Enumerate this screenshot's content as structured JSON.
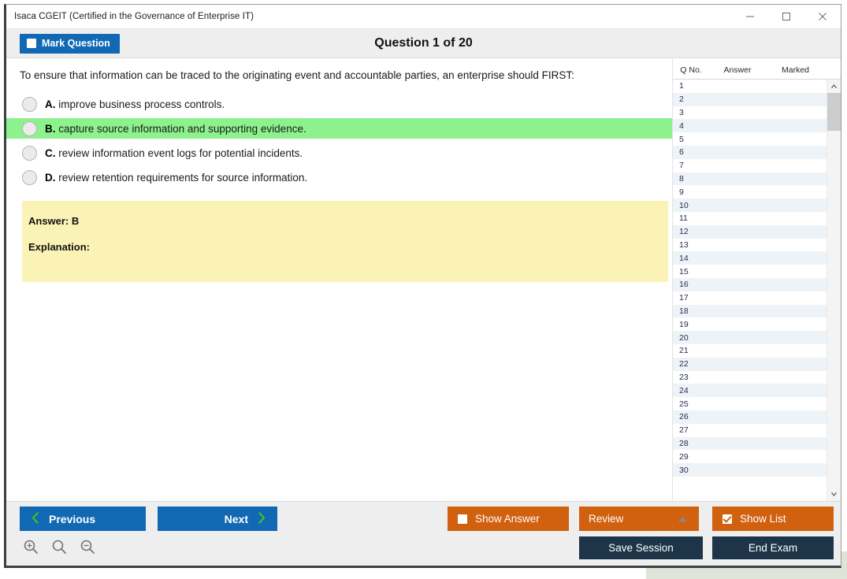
{
  "window": {
    "title": "Isaca CGEIT (Certified in the Governance of Enterprise IT)",
    "controls": {
      "minimize": "minimize-icon",
      "maximize": "maximize-icon",
      "close": "close-icon"
    }
  },
  "topbar": {
    "mark_question_label": "Mark Question",
    "mark_question_checked": false,
    "question_counter": "Question 1 of 20"
  },
  "question": {
    "text": "To ensure that information can be traced to the originating event and accountable parties, an enterprise should FIRST:",
    "options": [
      {
        "letter": "A.",
        "text": "improve business process controls.",
        "selected": false
      },
      {
        "letter": "B.",
        "text": "capture source information and supporting evidence.",
        "selected": true
      },
      {
        "letter": "C.",
        "text": "review information event logs for potential incidents.",
        "selected": false
      },
      {
        "letter": "D.",
        "text": "review retention requirements for source information.",
        "selected": false
      }
    ]
  },
  "answer_panel": {
    "answer_label": "Answer: B",
    "explanation_label": "Explanation:"
  },
  "list_panel": {
    "columns": [
      "Q No.",
      "Answer",
      "Marked"
    ],
    "rows": [
      {
        "no": "1",
        "answer": "",
        "marked": ""
      },
      {
        "no": "2",
        "answer": "",
        "marked": ""
      },
      {
        "no": "3",
        "answer": "",
        "marked": ""
      },
      {
        "no": "4",
        "answer": "",
        "marked": ""
      },
      {
        "no": "5",
        "answer": "",
        "marked": ""
      },
      {
        "no": "6",
        "answer": "",
        "marked": ""
      },
      {
        "no": "7",
        "answer": "",
        "marked": ""
      },
      {
        "no": "8",
        "answer": "",
        "marked": ""
      },
      {
        "no": "9",
        "answer": "",
        "marked": ""
      },
      {
        "no": "10",
        "answer": "",
        "marked": ""
      },
      {
        "no": "11",
        "answer": "",
        "marked": ""
      },
      {
        "no": "12",
        "answer": "",
        "marked": ""
      },
      {
        "no": "13",
        "answer": "",
        "marked": ""
      },
      {
        "no": "14",
        "answer": "",
        "marked": ""
      },
      {
        "no": "15",
        "answer": "",
        "marked": ""
      },
      {
        "no": "16",
        "answer": "",
        "marked": ""
      },
      {
        "no": "17",
        "answer": "",
        "marked": ""
      },
      {
        "no": "18",
        "answer": "",
        "marked": ""
      },
      {
        "no": "19",
        "answer": "",
        "marked": ""
      },
      {
        "no": "20",
        "answer": "",
        "marked": ""
      },
      {
        "no": "21",
        "answer": "",
        "marked": ""
      },
      {
        "no": "22",
        "answer": "",
        "marked": ""
      },
      {
        "no": "23",
        "answer": "",
        "marked": ""
      },
      {
        "no": "24",
        "answer": "",
        "marked": ""
      },
      {
        "no": "25",
        "answer": "",
        "marked": ""
      },
      {
        "no": "26",
        "answer": "",
        "marked": ""
      },
      {
        "no": "27",
        "answer": "",
        "marked": ""
      },
      {
        "no": "28",
        "answer": "",
        "marked": ""
      },
      {
        "no": "29",
        "answer": "",
        "marked": ""
      },
      {
        "no": "30",
        "answer": "",
        "marked": ""
      }
    ],
    "scrollbar": {
      "up_arrow": "chevron-up-icon",
      "down_arrow": "chevron-down-icon"
    }
  },
  "bottombar": {
    "previous_label": "Previous",
    "next_label": "Next",
    "show_answer_label": "Show Answer",
    "show_answer_checked": false,
    "review_label": "Review",
    "show_list_label": "Show List",
    "show_list_checked": true,
    "save_session_label": "Save Session",
    "end_exam_label": "End Exam",
    "zoom_in": "zoom-in-icon",
    "zoom_reset": "zoom-reset-icon",
    "zoom_out": "zoom-out-icon"
  },
  "colors": {
    "primary_blue": "#1168b3",
    "accent_orange": "#d1600f",
    "dark_navy": "#1d3449",
    "selected_green": "#8df28d",
    "answer_yellow": "#fbf3b6",
    "chevron_green": "#3bbf2e"
  }
}
